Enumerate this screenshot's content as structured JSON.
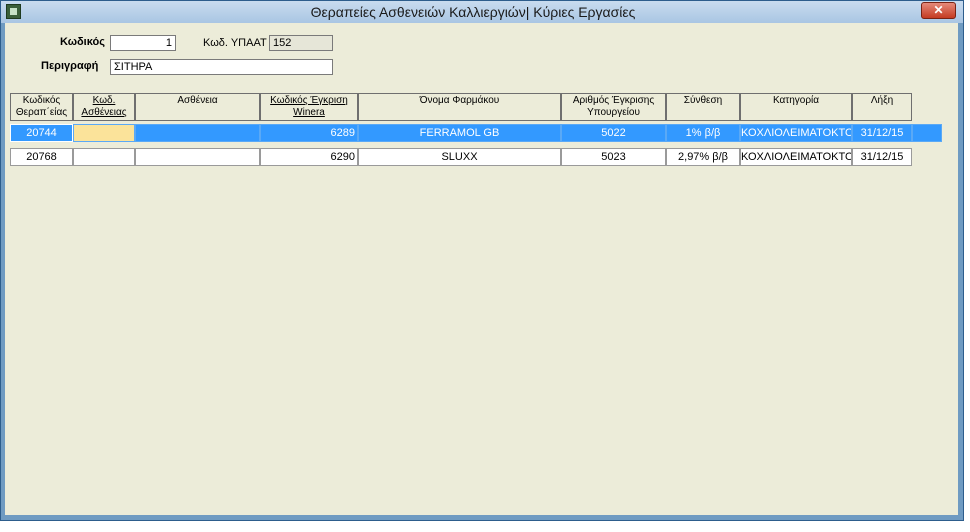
{
  "window": {
    "title": "Θεραπείες Ασθενειών Καλλιεργιών| Κύριες Εργασίες",
    "close_label": "✕"
  },
  "form": {
    "code_label": "Κωδικός",
    "code_value": "1",
    "ypaat_label": "Κωδ. ΥΠΑΑΤ",
    "ypaat_value": "152",
    "desc_label": "Περιγραφή",
    "desc_value": "ΣΙΤΗΡΑ"
  },
  "table": {
    "headers": [
      "Κωδικός\nΘεραπ΄είας",
      "Κωδ.\nΑσθένειας",
      "Ασθένεια",
      "Κωδικός Έγκριση\nWinera",
      "Όνομα Φαρμάκου",
      "Αριθμός Έγκρισης\nΥπουργείου",
      "Σύνθεση",
      "Κατηγορία",
      "Λήξη"
    ],
    "rows": [
      {
        "therapy_code": "20744",
        "disease_code": "",
        "disease": "",
        "winera_code": "6289",
        "drug_name": "FERRAMOL GB",
        "ministry_approval": "5022",
        "composition": "1% β/β",
        "category": "ΚΟΧΛΙΟΛΕΙΜΑΤΟΚΤΟΝΑ",
        "expiry": "31/12/15",
        "selected": true
      },
      {
        "therapy_code": "20768",
        "disease_code": "",
        "disease": "",
        "winera_code": "6290",
        "drug_name": "SLUXX",
        "ministry_approval": "5023",
        "composition": "2,97% β/β",
        "category": "ΚΟΧΛΙΟΛΕΙΜΑΤΟΚΤΟΝΑ",
        "expiry": "31/12/15",
        "selected": false
      }
    ]
  },
  "colors": {
    "selection": "#3399ff",
    "edit_cell": "#fbe39a",
    "client_bg": "#ececd9"
  }
}
